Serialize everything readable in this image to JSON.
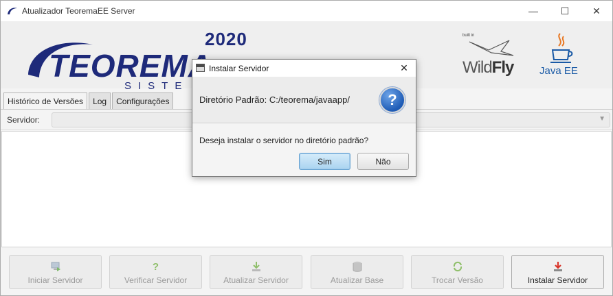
{
  "window": {
    "title": "Atualizador TeoremaEE Server",
    "minimize_symbol": "—",
    "maximize_symbol": "☐",
    "close_symbol": "✕"
  },
  "banner": {
    "year": "2020",
    "brand": "TEOREMA",
    "brand_sub": "SISTE",
    "wildfly_builtin": "built in",
    "wildfly_wild": "Wild",
    "wildfly_fly": "Fly",
    "javaee_label": "Java EE"
  },
  "tabs": [
    {
      "label": "Histórico de Versões",
      "active": true
    },
    {
      "label": "Log",
      "active": false
    },
    {
      "label": "Configurações",
      "active": false
    }
  ],
  "server": {
    "label": "Servidor:",
    "value": ""
  },
  "actions": [
    {
      "label": "Iniciar Servidor",
      "icon": "start-server-icon",
      "enabled": false
    },
    {
      "label": "Verificar Servidor",
      "icon": "check-server-icon",
      "enabled": false
    },
    {
      "label": "Atualizar Servidor",
      "icon": "update-server-icon",
      "enabled": false
    },
    {
      "label": "Atualizar Base",
      "icon": "database-icon",
      "enabled": false
    },
    {
      "label": "Trocar Versão",
      "icon": "swap-version-icon",
      "enabled": false
    },
    {
      "label": "Instalar Servidor",
      "icon": "install-server-icon",
      "enabled": true
    }
  ],
  "dialog": {
    "title": "Instalar Servidor",
    "close_symbol": "✕",
    "header_text": "Diretório Padrão: C:/teorema/javaapp/",
    "question_symbol": "?",
    "content_text": "Deseja instalar o servidor no diretório padrão?",
    "yes_label": "Sim",
    "no_label": "Não"
  },
  "colors": {
    "brand_blue": "#1e2a7a",
    "default_button": "#a9d3f0",
    "question_icon": "#1f5cb6"
  }
}
